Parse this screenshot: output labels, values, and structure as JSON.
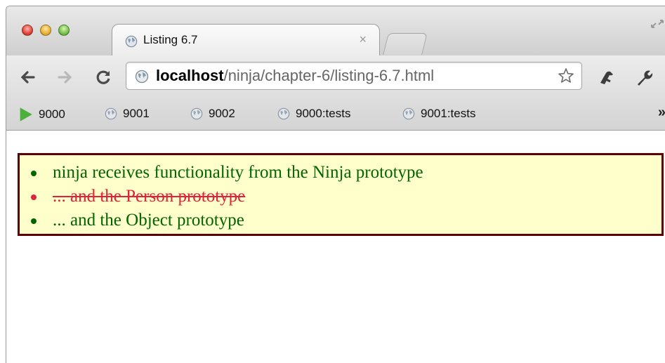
{
  "window": {
    "tab": {
      "title": "Listing 6.7",
      "close_glyph": "×",
      "icon": "globe-icon"
    }
  },
  "toolbar": {
    "url_host": "localhost",
    "url_path": "/ninja/chapter-6/listing-6.7.html",
    "icons": [
      "back-arrow-icon",
      "forward-arrow-icon",
      "reload-icon",
      "globe-icon",
      "star-icon",
      "extension-icon",
      "wrench-icon"
    ]
  },
  "bookmarks": {
    "items": [
      {
        "label": "9000",
        "icon": "play-icon"
      },
      {
        "label": "9001",
        "icon": "globe-icon"
      },
      {
        "label": "9002",
        "icon": "globe-icon"
      },
      {
        "label": "9000:tests",
        "icon": "globe-icon"
      },
      {
        "label": "9001:tests",
        "icon": "globe-icon"
      }
    ],
    "more_label": "»"
  },
  "page": {
    "results": [
      {
        "text": "ninja receives functionality from the Ninja prototype",
        "status": "pass",
        "color": "#006400"
      },
      {
        "text": "... and the Person prototype",
        "status": "fail",
        "color": "#e0223a"
      },
      {
        "text": "... and the Object prototype",
        "status": "pass",
        "color": "#006400"
      }
    ],
    "box_background": "#ffffcc",
    "box_border": "#5c0000"
  }
}
